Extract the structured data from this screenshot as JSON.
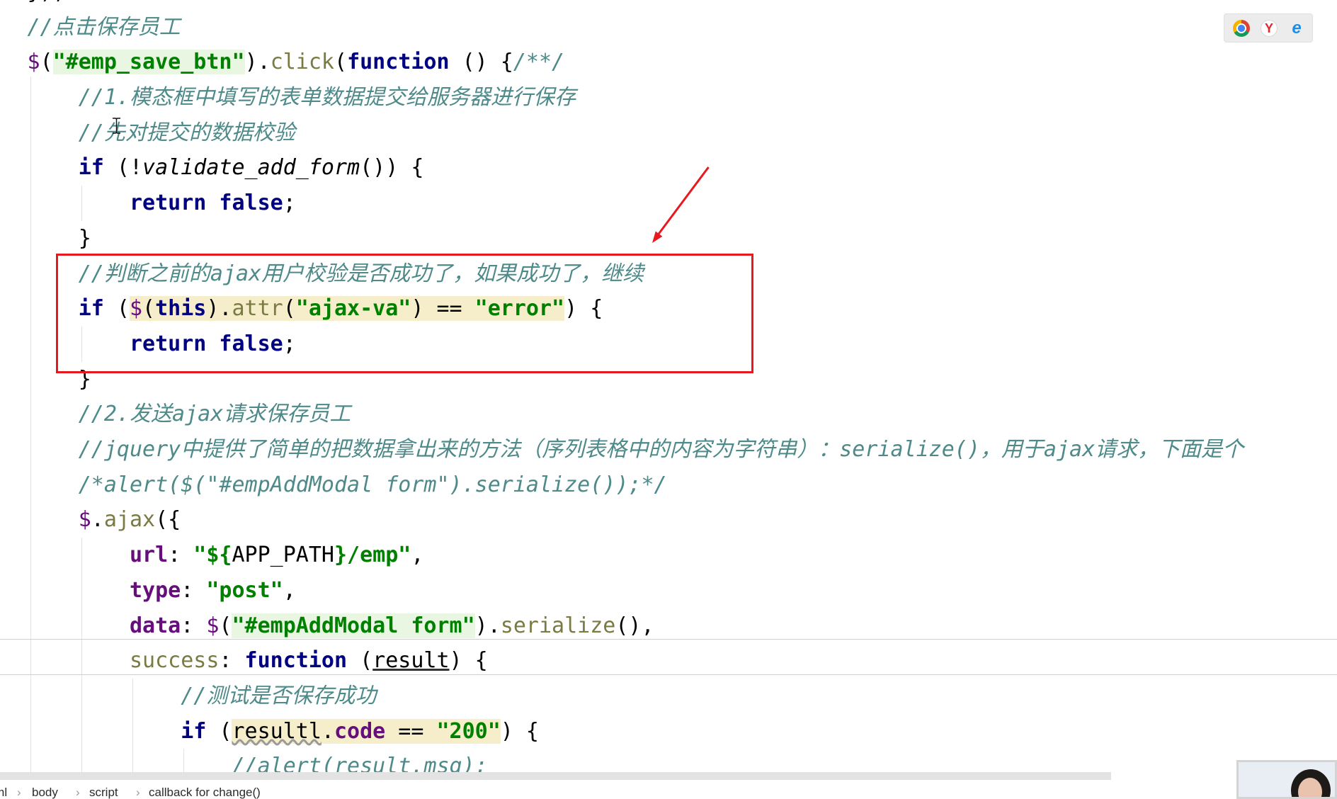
{
  "syntax_colors": {
    "keyword": "#000080",
    "string": "#008000",
    "comment": "#4e8a89",
    "method": "#7a7a43",
    "property": "#660e7a",
    "dollar": "#660e7a",
    "plain": "#000000",
    "highlight_yellow": "#f6eecb",
    "highlight_green": "#e9f6e2",
    "guide": "#e2e2e2",
    "annotation_red": "#e8191e"
  },
  "editor": {
    "lines": [
      {
        "indent": 0,
        "tokens": [
          {
            "t": "});",
            "k": "plain"
          }
        ]
      },
      {
        "indent": 0,
        "tokens": [
          {
            "t": "//点击保存员工",
            "k": "comment"
          }
        ]
      },
      {
        "indent": 0,
        "tokens": [
          {
            "t": "$",
            "k": "dollar"
          },
          {
            "t": "(",
            "k": "plain"
          },
          {
            "t": "\"#emp_save_btn\"",
            "k": "string",
            "bg": "green"
          },
          {
            "t": ").",
            "k": "plain"
          },
          {
            "t": "click",
            "k": "method"
          },
          {
            "t": "(",
            "k": "plain"
          },
          {
            "t": "function",
            "k": "keyword"
          },
          {
            "t": " () {",
            "k": "plain"
          },
          {
            "t": "/**/",
            "k": "comment"
          }
        ]
      },
      {
        "indent": 1,
        "tokens": [
          {
            "t": "//1.模态框中填写的表单数据提交给服务器进行保存",
            "k": "comment"
          }
        ]
      },
      {
        "indent": 1,
        "tokens": [
          {
            "t": "//先对提交的数据校验",
            "k": "comment"
          }
        ]
      },
      {
        "indent": 1,
        "tokens": [
          {
            "t": "if",
            "k": "keyword"
          },
          {
            "t": " (!",
            "k": "plain"
          },
          {
            "t": "validate_add_form",
            "k": "italic"
          },
          {
            "t": "()) {",
            "k": "plain"
          }
        ]
      },
      {
        "indent": 2,
        "tokens": [
          {
            "t": "return",
            "k": "keyword"
          },
          {
            "t": " ",
            "k": "plain"
          },
          {
            "t": "false",
            "k": "keyword"
          },
          {
            "t": ";",
            "k": "plain"
          }
        ]
      },
      {
        "indent": 1,
        "tokens": [
          {
            "t": "}",
            "k": "plain"
          }
        ]
      },
      {
        "indent": 1,
        "tokens": [
          {
            "t": "//判断之前的ajax用户校验是否成功了，如果成功了，继续",
            "k": "comment"
          }
        ]
      },
      {
        "indent": 1,
        "tokens": [
          {
            "t": "if",
            "k": "keyword"
          },
          {
            "t": " (",
            "k": "plain"
          },
          {
            "t": "$",
            "k": "dollar",
            "bg": "yellow"
          },
          {
            "t": "(",
            "k": "plain",
            "bg": "yellow"
          },
          {
            "t": "this",
            "k": "keyword",
            "bg": "yellow"
          },
          {
            "t": ").",
            "k": "plain",
            "bg": "yellow"
          },
          {
            "t": "attr",
            "k": "method",
            "bg": "yellow"
          },
          {
            "t": "(",
            "k": "plain",
            "bg": "yellow"
          },
          {
            "t": "\"ajax-va\"",
            "k": "string",
            "bg": "yellow"
          },
          {
            "t": ") == ",
            "k": "plain",
            "bg": "yellow"
          },
          {
            "t": "\"error\"",
            "k": "string",
            "bg": "yellow"
          },
          {
            "t": ") {",
            "k": "plain"
          }
        ]
      },
      {
        "indent": 2,
        "tokens": [
          {
            "t": "return",
            "k": "keyword"
          },
          {
            "t": " ",
            "k": "plain"
          },
          {
            "t": "false",
            "k": "keyword"
          },
          {
            "t": ";",
            "k": "plain"
          }
        ]
      },
      {
        "indent": 1,
        "tokens": [
          {
            "t": "}",
            "k": "plain"
          }
        ]
      },
      {
        "indent": 1,
        "tokens": [
          {
            "t": "//2.发送ajax请求保存员工",
            "k": "comment"
          }
        ]
      },
      {
        "indent": 1,
        "tokens": [
          {
            "t": "//jquery中提供了简单的把数据拿出来的方法（序列表格中的内容为字符串）：serialize()，用于ajax请求，下面是个",
            "k": "comment"
          }
        ]
      },
      {
        "indent": 1,
        "tokens": [
          {
            "t": "/*alert($(\"#empAddModal form\").serialize());*/",
            "k": "comment"
          }
        ]
      },
      {
        "indent": 1,
        "tokens": [
          {
            "t": "$",
            "k": "dollar"
          },
          {
            "t": ".",
            "k": "plain"
          },
          {
            "t": "ajax",
            "k": "method"
          },
          {
            "t": "({",
            "k": "plain"
          }
        ]
      },
      {
        "indent": 2,
        "tokens": [
          {
            "t": "url",
            "k": "property"
          },
          {
            "t": ": ",
            "k": "plain"
          },
          {
            "t": "\"${",
            "k": "string"
          },
          {
            "t": "APP_PATH",
            "k": "plain"
          },
          {
            "t": "}/emp\"",
            "k": "string"
          },
          {
            "t": ",",
            "k": "plain"
          }
        ]
      },
      {
        "indent": 2,
        "tokens": [
          {
            "t": "type",
            "k": "property"
          },
          {
            "t": ": ",
            "k": "plain"
          },
          {
            "t": "\"post\"",
            "k": "string"
          },
          {
            "t": ",",
            "k": "plain"
          }
        ]
      },
      {
        "indent": 2,
        "tokens": [
          {
            "t": "data",
            "k": "property"
          },
          {
            "t": ": ",
            "k": "plain"
          },
          {
            "t": "$",
            "k": "dollar"
          },
          {
            "t": "(",
            "k": "plain"
          },
          {
            "t": "\"#empAddModal form\"",
            "k": "string",
            "bg": "green"
          },
          {
            "t": ").",
            "k": "plain"
          },
          {
            "t": "serialize",
            "k": "method"
          },
          {
            "t": "(),",
            "k": "plain"
          }
        ]
      },
      {
        "indent": 2,
        "tokens": [
          {
            "t": "success",
            "k": "method"
          },
          {
            "t": ": ",
            "k": "plain"
          },
          {
            "t": "function",
            "k": "keyword"
          },
          {
            "t": " (",
            "k": "plain"
          },
          {
            "t": "result",
            "k": "plain",
            "u": "solid"
          },
          {
            "t": ") {",
            "k": "plain"
          }
        ]
      },
      {
        "indent": 3,
        "tokens": [
          {
            "t": "//测试是否保存成功",
            "k": "comment"
          }
        ]
      },
      {
        "indent": 3,
        "tokens": [
          {
            "t": "if",
            "k": "keyword"
          },
          {
            "t": " (",
            "k": "plain"
          },
          {
            "t": "resultl",
            "k": "plain",
            "bg": "yellow",
            "u": "wavy"
          },
          {
            "t": ".",
            "k": "plain",
            "bg": "yellow"
          },
          {
            "t": "code",
            "k": "property",
            "bg": "yellow"
          },
          {
            "t": " == ",
            "k": "plain",
            "bg": "yellow"
          },
          {
            "t": "\"200\"",
            "k": "string",
            "bg": "yellow"
          },
          {
            "t": ") {",
            "k": "plain"
          }
        ]
      },
      {
        "indent": 4,
        "tokens": [
          {
            "t": "//alert(result.msg);",
            "k": "comment"
          }
        ]
      }
    ]
  },
  "browser_icons": [
    {
      "name": "chrome-icon"
    },
    {
      "name": "yandex-icon",
      "glyph": "Y"
    },
    {
      "name": "ie-icon",
      "glyph": "e"
    }
  ],
  "breadcrumb": {
    "items": [
      "html",
      "body",
      "script",
      "callback for change()"
    ],
    "separator": "›"
  }
}
